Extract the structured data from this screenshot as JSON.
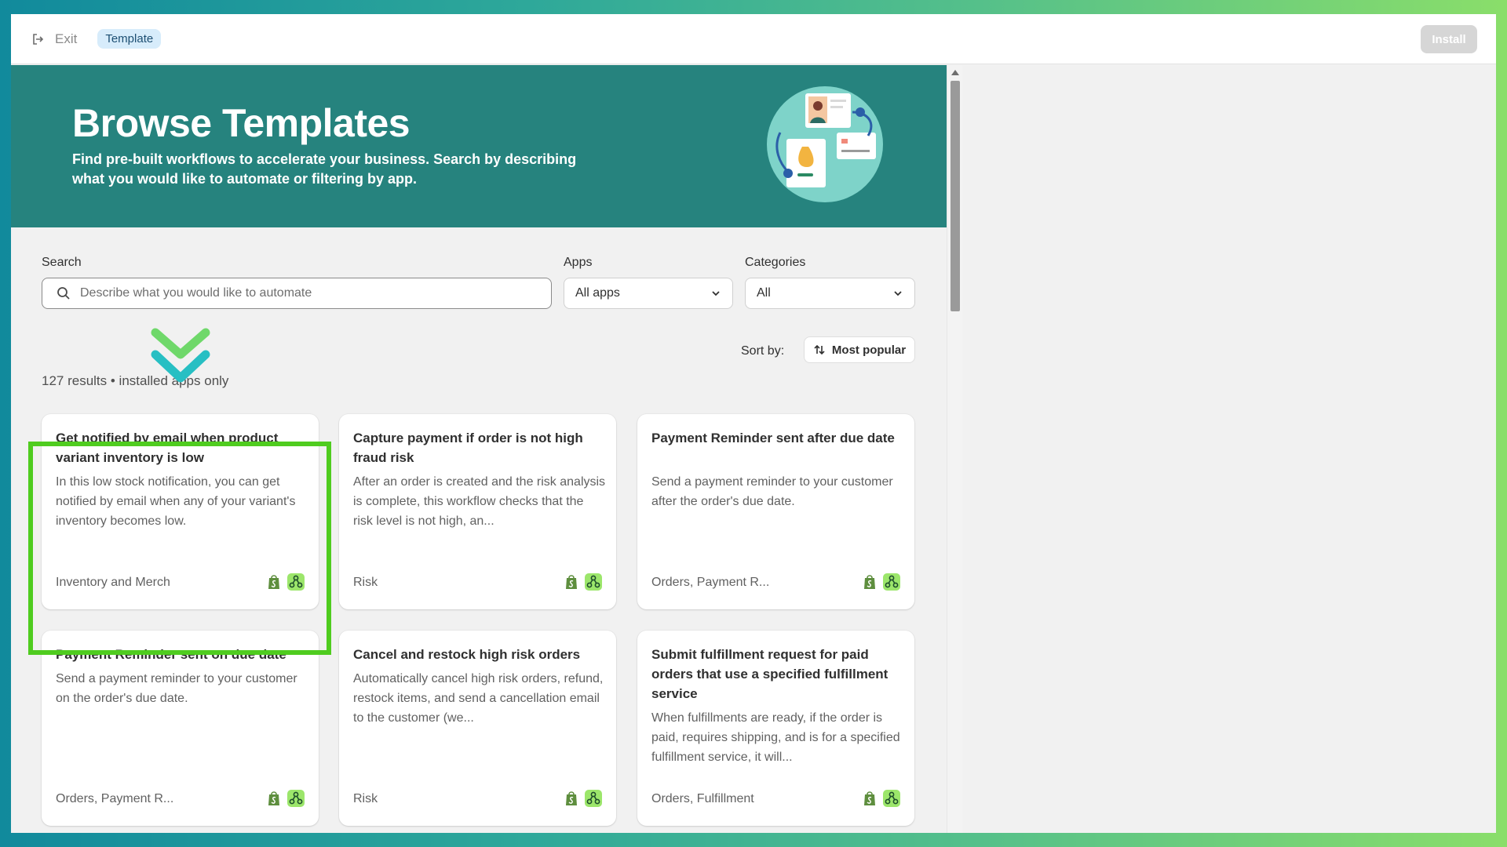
{
  "topbar": {
    "exit_label": "Exit",
    "badge_label": "Template",
    "install_label": "Install"
  },
  "hero": {
    "title": "Browse Templates",
    "description": "Find pre-built workflows to accelerate your business. Search by describing what you would like to automate or filtering by app."
  },
  "filters": {
    "search_label": "Search",
    "search_placeholder": "Describe what you would like to automate",
    "apps_label": "Apps",
    "apps_value": "All apps",
    "categories_label": "Categories",
    "categories_value": "All",
    "sort_label": "Sort by:",
    "sort_value": "Most popular"
  },
  "results_text": "127 results • installed apps only",
  "cards": [
    {
      "title": "Get notified by email when product variant inventory is low",
      "description": "In this low stock notification, you can get notified by email when any of your variant's inventory becomes low.",
      "category": "Inventory and Merch"
    },
    {
      "title": "Capture payment if order is not high fraud risk",
      "description": "After an order is created and the risk analysis is complete, this workflow checks that the risk level is not high, an...",
      "category": "Risk"
    },
    {
      "title": "Payment Reminder sent after due date",
      "description": "Send a payment reminder to your customer after the order's due date.",
      "category": "Orders, Payment R..."
    },
    {
      "title": "Payment Reminder sent on due date",
      "description": "Send a payment reminder to your customer on the order's due date.",
      "category": "Orders, Payment R..."
    },
    {
      "title": "Cancel and restock high risk orders",
      "description": "Automatically cancel high risk orders, refund, restock items, and send a cancellation email to the customer (we...",
      "category": "Risk"
    },
    {
      "title": "Submit fulfillment request for paid orders that use a specified fulfillment service",
      "description": "When fulfillments are ready, if the order is paid, requires shipping, and is for a specified fulfillment service, it will...",
      "category": "Orders, Fulfillment"
    }
  ],
  "icons": {
    "card_app_icons": [
      "shopify-icon",
      "flow-icon"
    ]
  },
  "colors": {
    "hero_bg": "#26837e",
    "highlight": "#4fcc1f",
    "shopify_green": "#5e8e3e",
    "flow_green": "#9ce66b"
  }
}
